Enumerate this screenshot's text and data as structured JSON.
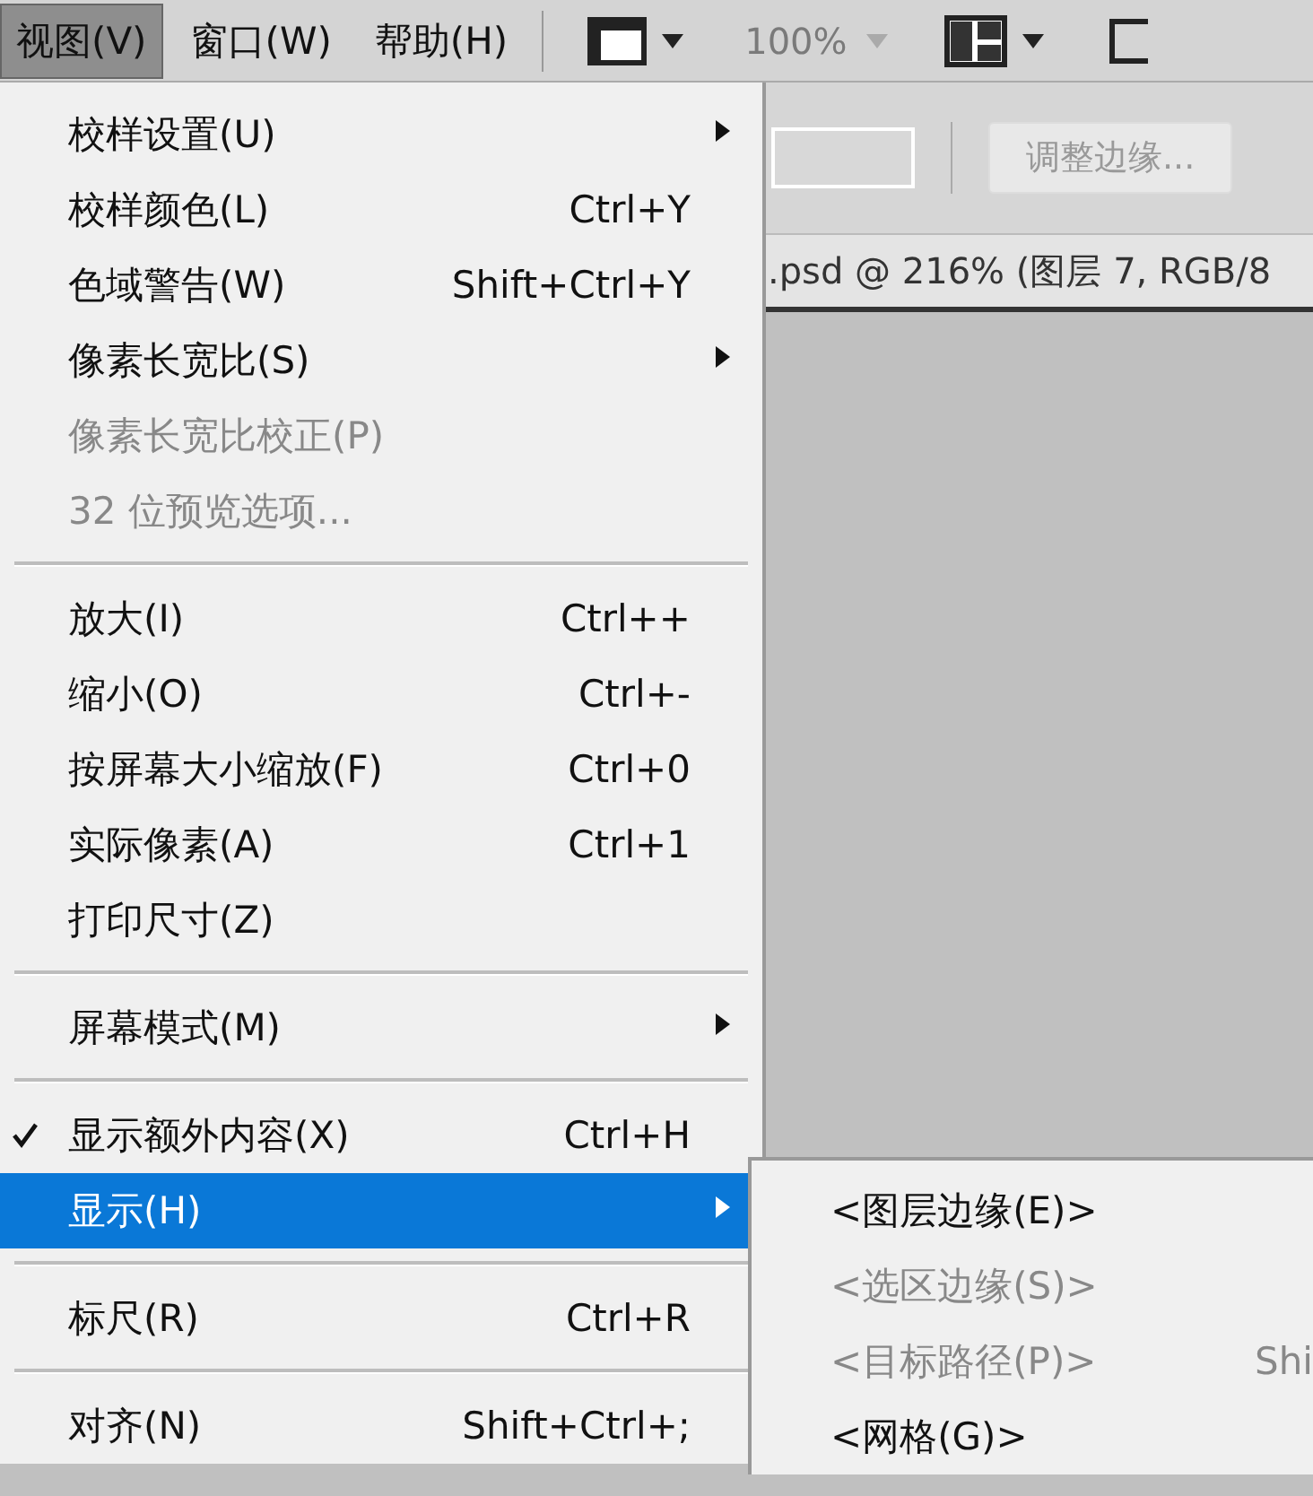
{
  "menubar": [
    {
      "label": "视图(V)",
      "selected": true
    },
    {
      "label": "窗口(W)",
      "selected": false
    },
    {
      "label": "帮助(H)",
      "selected": false
    }
  ],
  "toolbar": {
    "zoom": "100%"
  },
  "options_bar": {
    "button": "调整边缘..."
  },
  "document_tab": {
    "title": ".psd @ 216% (图层 7, RGB/8"
  },
  "menu": [
    {
      "kind": "item",
      "label": "校样设置(U)",
      "submenu": true,
      "disabled": false,
      "checked": false,
      "selected": false
    },
    {
      "kind": "item",
      "label": "校样颜色(L)",
      "shortcut": "Ctrl+Y",
      "disabled": false,
      "checked": false,
      "selected": false
    },
    {
      "kind": "item",
      "label": "色域警告(W)",
      "shortcut": "Shift+Ctrl+Y",
      "disabled": false,
      "checked": false,
      "selected": false
    },
    {
      "kind": "item",
      "label": "像素长宽比(S)",
      "submenu": true,
      "disabled": false,
      "checked": false,
      "selected": false
    },
    {
      "kind": "item",
      "label": "像素长宽比校正(P)",
      "disabled": true,
      "checked": false,
      "selected": false
    },
    {
      "kind": "item",
      "label": "32 位预览选项...",
      "disabled": true,
      "checked": false,
      "selected": false
    },
    {
      "kind": "separator"
    },
    {
      "kind": "item",
      "label": "放大(I)",
      "shortcut": "Ctrl++",
      "disabled": false,
      "checked": false,
      "selected": false
    },
    {
      "kind": "item",
      "label": "缩小(O)",
      "shortcut": "Ctrl+-",
      "disabled": false,
      "checked": false,
      "selected": false
    },
    {
      "kind": "item",
      "label": "按屏幕大小缩放(F)",
      "shortcut": "Ctrl+0",
      "disabled": false,
      "checked": false,
      "selected": false
    },
    {
      "kind": "item",
      "label": "实际像素(A)",
      "shortcut": "Ctrl+1",
      "disabled": false,
      "checked": false,
      "selected": false
    },
    {
      "kind": "item",
      "label": "打印尺寸(Z)",
      "disabled": false,
      "checked": false,
      "selected": false
    },
    {
      "kind": "separator"
    },
    {
      "kind": "item",
      "label": "屏幕模式(M)",
      "submenu": true,
      "disabled": false,
      "checked": false,
      "selected": false
    },
    {
      "kind": "separator"
    },
    {
      "kind": "item",
      "label": "显示额外内容(X)",
      "shortcut": "Ctrl+H",
      "disabled": false,
      "checked": true,
      "selected": false
    },
    {
      "kind": "item",
      "label": "显示(H)",
      "submenu": true,
      "disabled": false,
      "checked": false,
      "selected": true
    },
    {
      "kind": "separator"
    },
    {
      "kind": "item",
      "label": "标尺(R)",
      "shortcut": "Ctrl+R",
      "disabled": false,
      "checked": false,
      "selected": false
    },
    {
      "kind": "separator"
    },
    {
      "kind": "item",
      "label": "对齐(N)",
      "shortcut": "Shift+Ctrl+;",
      "disabled": false,
      "checked": false,
      "selected": false
    }
  ],
  "submenu": [
    {
      "label": "<图层边缘(E)>",
      "disabled": false
    },
    {
      "label": "<选区边缘(S)>",
      "disabled": true
    },
    {
      "label": "<目标路径(P)>",
      "shortcut": "Shi",
      "disabled": true
    },
    {
      "label": "<网格(G)>",
      "disabled": false
    }
  ]
}
